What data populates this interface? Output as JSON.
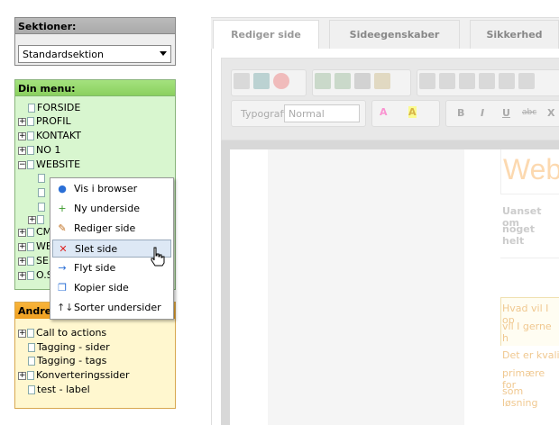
{
  "sektioner": {
    "title": "Sektioner:",
    "selected": "Standardsektion"
  },
  "din_menu": {
    "title": "Din menu:",
    "items": [
      {
        "label": "FORSIDE",
        "expander": ""
      },
      {
        "label": "PROFIL",
        "expander": "+"
      },
      {
        "label": "KONTAKT",
        "expander": "+"
      },
      {
        "label": "NO 1",
        "expander": "+"
      },
      {
        "label": "WEBSITE",
        "expander": "-"
      },
      {
        "label": "CM",
        "expander": "+"
      },
      {
        "label": "WE",
        "expander": "+"
      },
      {
        "label": "SE",
        "expander": "+"
      },
      {
        "label": "O.S",
        "expander": "+"
      }
    ]
  },
  "andre": {
    "title": "Andre",
    "items": [
      {
        "label": "Call to actions",
        "expander": "+"
      },
      {
        "label": "Tagging - sider",
        "expander": ""
      },
      {
        "label": "Tagging - tags",
        "expander": ""
      },
      {
        "label": "Konverteringssider",
        "expander": "+"
      },
      {
        "label": "test - label",
        "expander": ""
      }
    ]
  },
  "context_menu": [
    {
      "label": "Vis i browser",
      "icon": "globe-icon",
      "glyph": "●",
      "color": "#2b6fd6"
    },
    {
      "label": "Ny underside",
      "icon": "new-page-icon",
      "glyph": "+",
      "color": "#3a9a2a"
    },
    {
      "label": "Rediger side",
      "icon": "edit-icon",
      "glyph": "✎",
      "color": "#c07020"
    },
    {
      "label": "Slet side",
      "icon": "delete-icon",
      "glyph": "✕",
      "color": "#d22"
    },
    {
      "label": "Flyt side",
      "icon": "move-icon",
      "glyph": "→",
      "color": "#2b6fd6"
    },
    {
      "label": "Kopier side",
      "icon": "copy-icon",
      "glyph": "❐",
      "color": "#2b6fd6"
    },
    {
      "label": "Sorter undersider",
      "icon": "sort-icon",
      "glyph": "↑↓",
      "color": "#333"
    }
  ],
  "tabs": [
    "Rediger side",
    "Sideegenskaber",
    "Sikkerhed"
  ],
  "toolbar": {
    "typografi_label": "Typografi",
    "style_value": "Normal"
  },
  "page": {
    "heading": "Web",
    "bold_text_1": "Uanset om",
    "bold_text_2": "noget helt",
    "para1_1": "Hvad vil I op",
    "para1_2": "vil I gerne h",
    "para2_1": "Det er kvali",
    "para2_2": "primære for",
    "para2_3": "som løsning"
  }
}
